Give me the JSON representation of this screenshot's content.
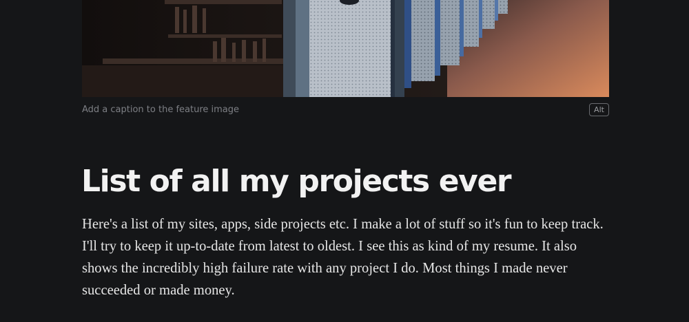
{
  "feature_image": {
    "caption_placeholder": "Add a caption to the feature image",
    "alt_label": "Alt"
  },
  "post": {
    "title": "List of all my projects ever",
    "body": "Here's a list of my sites, apps, side projects etc. I make a lot of stuff so it's fun to keep track. I'll try to keep it up-to-date from latest to oldest. I see this as kind of my resume. It also shows the incredibly high failure rate with any project I do. Most things I made never succeeded or made money."
  },
  "colors": {
    "background": "#151618",
    "title": "#f2f2f2",
    "body_text": "#e6e6e6",
    "caption_text": "#7d7f84"
  }
}
